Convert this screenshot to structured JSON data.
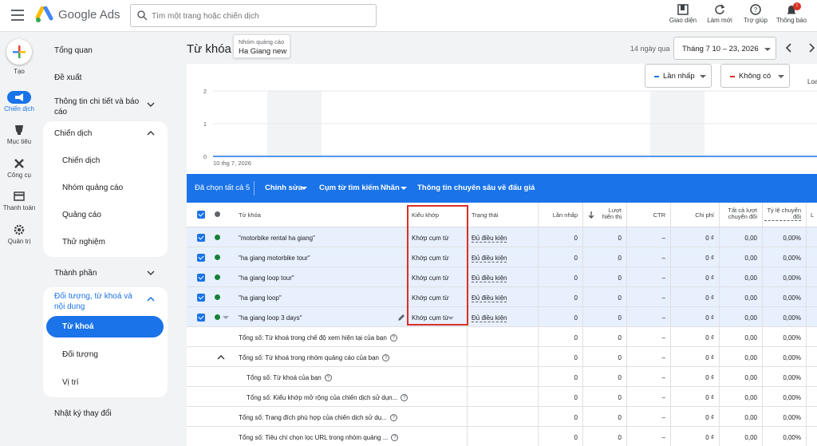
{
  "topbar": {
    "brand": "Google Ads",
    "search_placeholder": "Tìm một trang hoặc chiến dịch",
    "actions": [
      {
        "label": "Giao diện",
        "icon": "appearance-icon"
      },
      {
        "label": "Làm mới",
        "icon": "refresh-icon"
      },
      {
        "label": "Trợ giúp",
        "icon": "help-icon"
      },
      {
        "label": "Thông báo",
        "icon": "bell-icon",
        "badge": "!"
      }
    ]
  },
  "rail": {
    "create_label": "Tạo",
    "items": [
      {
        "label": "Chiến dịch",
        "icon": "megaphone-icon",
        "active": true
      },
      {
        "label": "Mục tiêu",
        "icon": "trophy-icon"
      },
      {
        "label": "Công cụ",
        "icon": "tools-icon"
      },
      {
        "label": "Thanh toán",
        "icon": "card-icon"
      },
      {
        "label": "Quản trị",
        "icon": "gear-icon"
      }
    ]
  },
  "sidenav": {
    "overview": "Tổng quan",
    "recommendations": "Đề xuất",
    "insights": "Thông tin chi tiết và báo cáo",
    "campaigns_section": "Chiến dịch",
    "campaigns_items": [
      "Chiến dịch",
      "Nhóm quảng cáo",
      "Quảng cáo",
      "Thử nghiệm"
    ],
    "assets": "Thành phần",
    "audiences_section": "Đối tượng, từ khoá và nội dung",
    "audiences_items": [
      "Từ khoá",
      "Đối tượng",
      "Vị trí"
    ],
    "change_history": "Nhật ký thay đổi"
  },
  "header": {
    "title": "Từ khóa",
    "adgroup_label": "Nhóm quảng cáo",
    "adgroup_value": "Ha Giang new",
    "range_label": "14 ngày qua",
    "date_range": "Tháng 7 10 – 23, 2026"
  },
  "chart": {
    "metrics": [
      {
        "label": "Lần nhấp",
        "color": "#1a73e8"
      },
      {
        "label": "Không có",
        "color": "#d93025"
      }
    ],
    "cut_label": "Loa",
    "y_ticks": [
      "2",
      "1",
      "0"
    ],
    "x_label": "10 thg 7, 2026"
  },
  "chart_data": {
    "type": "line",
    "x": [
      "10 thg 7, 2026"
    ],
    "ylim": [
      0,
      2
    ],
    "grid": true,
    "series": [
      {
        "name": "Lần nhấp",
        "values": [
          0
        ]
      }
    ]
  },
  "actionbar": {
    "selected": "Đã chọn tất cả 5",
    "edit": "Chỉnh sửa",
    "search_terms": "Cụm từ tìm kiếm",
    "label": "Nhãn",
    "bid_insights": "Thông tin chuyên sâu về đấu giá"
  },
  "table": {
    "headers": {
      "keyword": "Từ khóa",
      "match_type": "Kiểu khớp",
      "status": "Trạng thái",
      "clicks": "Lần nhấp",
      "impressions": "Lượt hiển thị",
      "ctr": "CTR",
      "cost": "Chi phí",
      "all_conv": "Tất cả lượt chuyển đổi",
      "conv_rate": "Tỷ lệ chuyển đổi",
      "cut": "L"
    },
    "rows": [
      {
        "keyword": "\"motorbike rental ha giang\"",
        "match": "Khớp cụm từ",
        "status": "Đủ điều kiện",
        "clicks": "0",
        "impr": "0",
        "ctr": "–",
        "cost": "0 ₫",
        "allconv": "0,00",
        "convrate": "0,00%"
      },
      {
        "keyword": "\"ha giang motorbike tour\"",
        "match": "Khớp cụm từ",
        "status": "Đủ điều kiện",
        "clicks": "0",
        "impr": "0",
        "ctr": "–",
        "cost": "0 ₫",
        "allconv": "0,00",
        "convrate": "0,00%"
      },
      {
        "keyword": "\"ha giang loop tour\"",
        "match": "Khớp cụm từ",
        "status": "Đủ điều kiện",
        "clicks": "0",
        "impr": "0",
        "ctr": "–",
        "cost": "0 ₫",
        "allconv": "0,00",
        "convrate": "0,00%"
      },
      {
        "keyword": "\"ha giang loop\"",
        "match": "Khớp cụm từ",
        "status": "Đủ điều kiện",
        "clicks": "0",
        "impr": "0",
        "ctr": "–",
        "cost": "0 ₫",
        "allconv": "0,00",
        "convrate": "0,00%"
      },
      {
        "keyword": "\"ha giang loop 3 days\"",
        "match": "Khớp cụm từ",
        "status": "Đủ điều kiện",
        "clicks": "0",
        "impr": "0",
        "ctr": "–",
        "cost": "0 ₫",
        "allconv": "0,00",
        "convrate": "0,00%"
      }
    ],
    "totals": [
      {
        "label": "Tổng số: Từ khoá trong chế độ xem hiện tại của bạn",
        "clicks": "0",
        "impr": "0",
        "ctr": "–",
        "cost": "0 ₫",
        "allconv": "0,00",
        "convrate": "0,00%"
      },
      {
        "label": "Tổng số: Từ khoá trong nhóm quảng cáo của bạn",
        "clicks": "0",
        "impr": "0",
        "ctr": "–",
        "cost": "0 ₫",
        "allconv": "0,00",
        "convrate": "0,00%"
      },
      {
        "label": "Tổng số: Từ khoá của bạn",
        "clicks": "0",
        "impr": "0",
        "ctr": "–",
        "cost": "0 ₫",
        "allconv": "0,00",
        "convrate": "0,00%"
      },
      {
        "label": "Tổng số: Kiểu khớp mở rộng của chiến dịch sử dụn...",
        "clicks": "0",
        "impr": "0",
        "ctr": "–",
        "cost": "0 ₫",
        "allconv": "0,00",
        "convrate": "0,00%"
      },
      {
        "label": "Tổng số: Trang đích phù hợp của chiến dịch sử dụ...",
        "clicks": "0",
        "impr": "0",
        "ctr": "–",
        "cost": "0 ₫",
        "allconv": "0,00",
        "convrate": "0,00%"
      },
      {
        "label": "Tổng số: Tiêu chí chọn lọc URL trong nhóm quảng ...",
        "clicks": "0",
        "impr": "0",
        "ctr": "–",
        "cost": "0 ₫",
        "allconv": "0,00",
        "convrate": "0,00%"
      }
    ]
  }
}
